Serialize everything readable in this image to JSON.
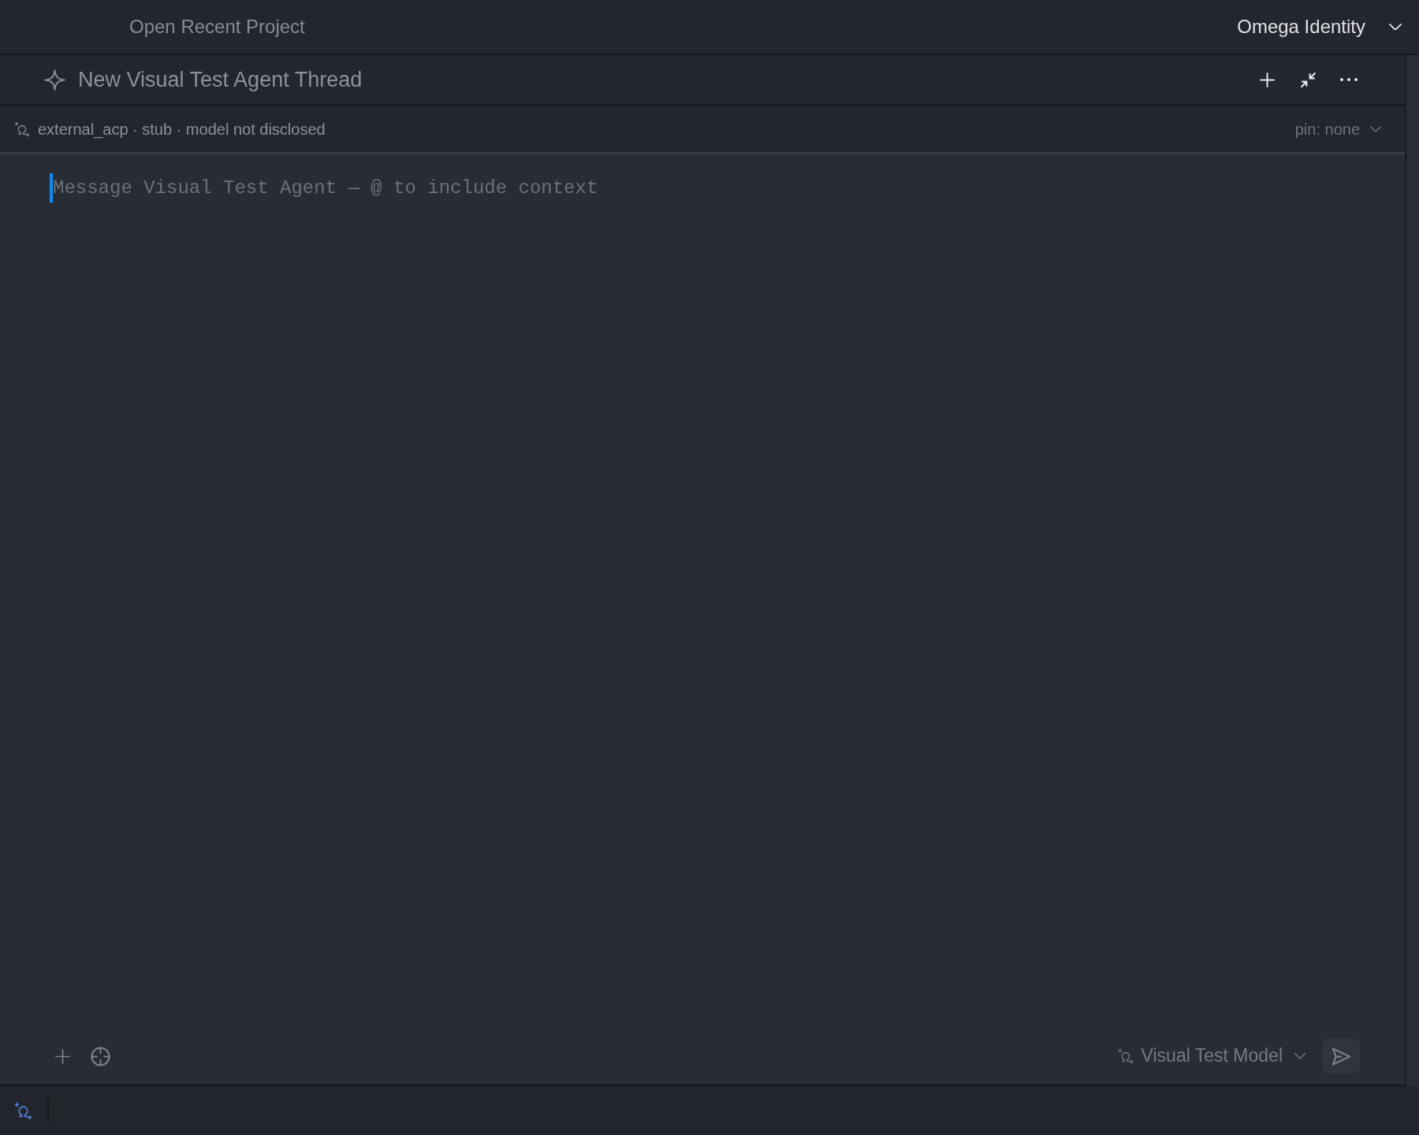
{
  "title_bar": {
    "recent_projects": "Open Recent Project",
    "identity": "Omega Identity"
  },
  "thread": {
    "title": "New Visual Test Agent Thread"
  },
  "agent_info": {
    "details": "external_acp · stub · model not disclosed",
    "pin": "pin: none"
  },
  "composer": {
    "placeholder": "Message Visual Test Agent — @ to include context",
    "focused": true,
    "model": "Visual Test Model"
  }
}
